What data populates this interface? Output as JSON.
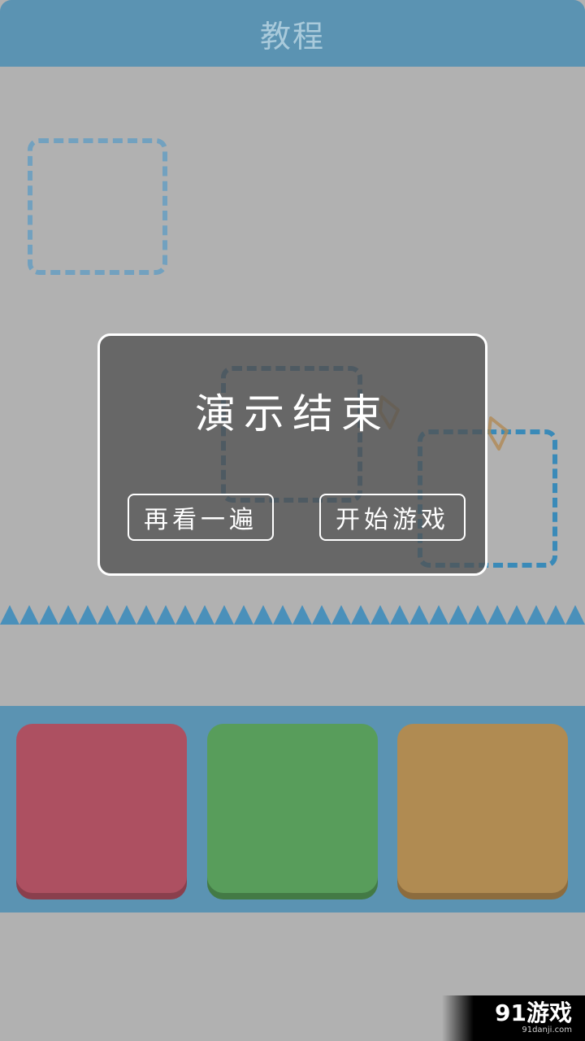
{
  "header": {
    "title": "教程"
  },
  "modal": {
    "title": "演示结束",
    "replay_label": "再看一遍",
    "start_label": "开始游戏"
  },
  "colors": {
    "header": "#5b93b2",
    "background": "#b1b1b1",
    "key_red": "#ad5061",
    "key_green": "#589d5b",
    "key_orange": "#b08b52",
    "spikes": "#4a90ba"
  },
  "watermark": {
    "logo": "91游戏",
    "url": "91danji.com"
  }
}
